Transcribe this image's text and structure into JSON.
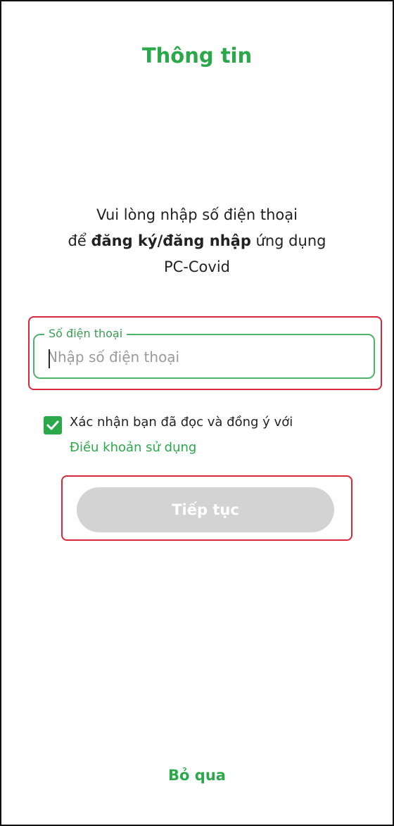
{
  "header": {
    "title": "Thông tin"
  },
  "intro": {
    "line1": "Vui lòng nhập số điện thoại",
    "line2_prefix": "để ",
    "line2_bold": "đăng ký/đăng nhập",
    "line2_suffix": " ứng dụng",
    "line3": "PC-Covid"
  },
  "phone_field": {
    "label": "Số điện thoại",
    "placeholder": "Nhập số điện thoại",
    "value": ""
  },
  "consent": {
    "checked": true,
    "text": "Xác nhận bạn đã đọc và đồng ý với",
    "terms_link": "Điều khoản sử dụng"
  },
  "actions": {
    "continue_label": "Tiếp tục",
    "skip_label": "Bỏ qua"
  },
  "colors": {
    "brand_green": "#2aa84a",
    "highlight_red": "#d9283a",
    "disabled_button": "#d3d3d3"
  }
}
